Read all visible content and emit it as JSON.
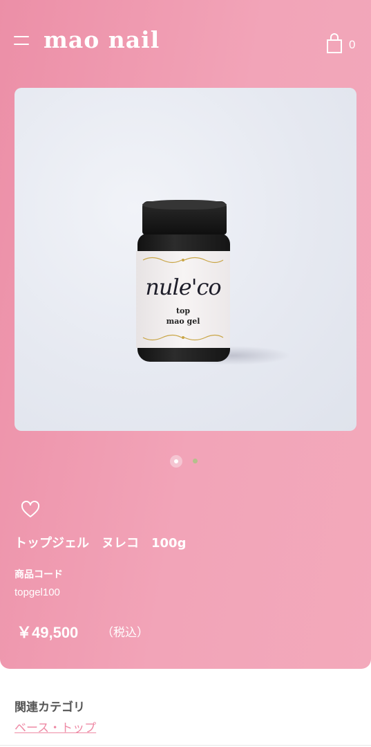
{
  "header": {
    "logo": "mao nail",
    "cart_count": "0",
    "menu_icon": "hamburger-icon",
    "cart_icon": "shopping-bag-icon"
  },
  "product": {
    "image_label_brand": "nule'co",
    "image_label_line1": "top",
    "image_label_line2": "mao gel",
    "title": "トップジェル　ヌレコ　100g",
    "code_label": "商品コード",
    "code_value": "topgel100",
    "price": "￥49,500",
    "tax_note": "（税込）",
    "favorite_icon": "heart-icon"
  },
  "gallery": {
    "slide_count": 2,
    "active_slide": 1
  },
  "related": {
    "label": "関連カテゴリ",
    "link": "ベース・トップ"
  },
  "colors": {
    "background_pink": "#f2a4b8",
    "link_pink": "#ee8aa5",
    "inactive_dot": "#b4c08c"
  }
}
